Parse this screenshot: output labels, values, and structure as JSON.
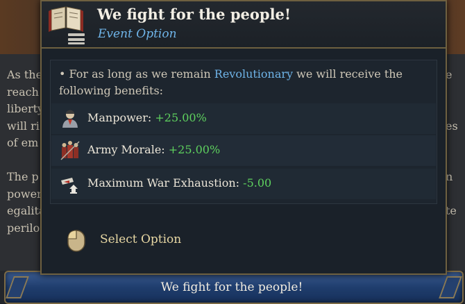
{
  "background": {
    "text_left_lines": [
      "As the",
      "reach",
      "liberty",
      "will ri",
      "of em",
      "",
      "The p",
      "power",
      "egalita",
      "perilo"
    ],
    "text_right_lines": [
      "e",
      "",
      "",
      "es",
      "",
      "",
      "n",
      "",
      "te",
      ""
    ]
  },
  "tooltip": {
    "title": "We fight for the people!",
    "subtitle": "Event Option",
    "icon": "book-icon",
    "intro_bullet": "•",
    "intro_pre": " For as long as we remain ",
    "intro_highlight": "Revolutionary",
    "intro_post": " we will receive the following benefits:",
    "modifiers": [
      {
        "icon": "manpower-icon",
        "label": "Manpower: ",
        "value": "+25.00%"
      },
      {
        "icon": "army-morale-icon",
        "label": "Army Morale: ",
        "value": "+25.00%"
      },
      {
        "icon": "war-exhaustion-icon",
        "label": "Maximum War Exhaustion: ",
        "value": "-5.00"
      }
    ],
    "select_label": "Select Option",
    "select_icon": "mouse-icon"
  },
  "option_bar": {
    "label": "We fight for the people!"
  },
  "colors": {
    "highlight": "#6fb4e8",
    "positive": "#5ed15e",
    "gold_border": "#6e6040",
    "option_blue": "#1f3d6d"
  }
}
